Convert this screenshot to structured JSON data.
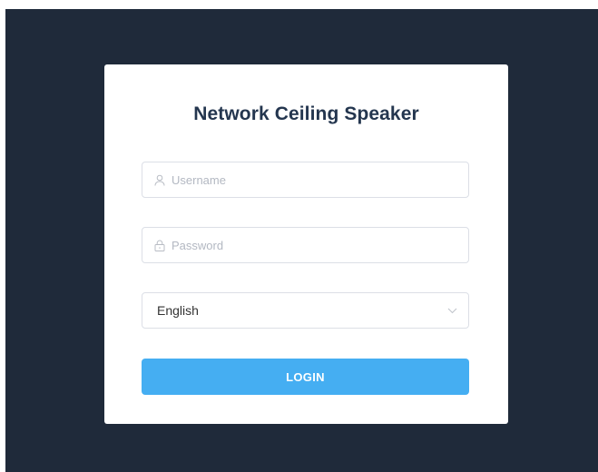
{
  "login_form": {
    "title": "Network Ceiling Speaker",
    "username": {
      "value": "",
      "placeholder": "Username",
      "icon": "user-icon"
    },
    "password": {
      "value": "",
      "placeholder": "Password",
      "icon": "lock-icon"
    },
    "language": {
      "selected": "English",
      "icon": "chevron-down-icon"
    },
    "login_label": "LOGIN"
  },
  "colors": {
    "background": "#1f2a3a",
    "card": "#ffffff",
    "title": "#24364f",
    "accent": "#45aef2",
    "border": "#dcdfe6",
    "placeholder": "#b3b8c2"
  }
}
